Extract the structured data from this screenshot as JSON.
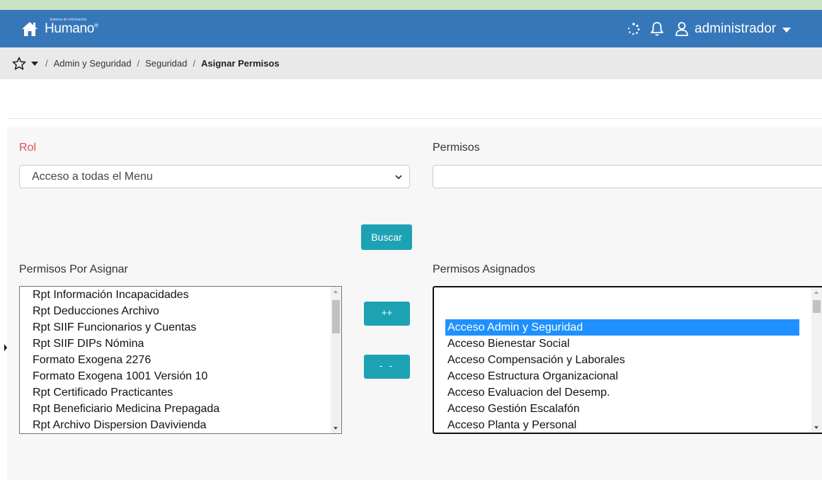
{
  "navbar": {
    "brand": "Humano",
    "brand_mark": "®",
    "brand_tagline": "Sistema de Información",
    "user": "administrador"
  },
  "breadcrumb": {
    "items": [
      "Admin y Seguridad",
      "Seguridad"
    ],
    "current": "Asignar Permisos",
    "separator": "/"
  },
  "form": {
    "rol_label": "Rol",
    "rol_value": "Acceso a todas el Menu",
    "permisos_label": "Permisos",
    "permisos_value": "",
    "buscar_label": "Buscar",
    "add_label": "++",
    "remove_label": "- -",
    "por_asignar_label": "Permisos Por Asignar",
    "asignados_label": "Permisos Asignados"
  },
  "por_asignar": [
    "Rpt Información Incapacidades",
    "Rpt Deducciones Archivo",
    "Rpt SIIF Funcionarios y Cuentas",
    "Rpt SIIF DIPs Nómina",
    "Formato Exogena 2276",
    "Formato Exogena 1001 Versión 10",
    "Rpt Certificado Practicantes",
    "Rpt Beneficiario Medicina Prepagada",
    "Rpt Archivo Dispersion Davivienda"
  ],
  "asignados": [
    "",
    "Acceso Admin y Seguridad",
    "Acceso Bienestar Social",
    "Acceso Compensación y Laborales",
    "Acceso Estructura Organizacional",
    "Acceso Evaluacion del Desemp.",
    "Acceso Gestión Escalafón",
    "Acceso Planta y Personal"
  ],
  "asignados_selected": "Acceso Admin y Seguridad",
  "colors": {
    "navbar": "#3677ba",
    "accent_button": "#1da2b4",
    "selection": "#1e90ff",
    "required_label": "#d9534f"
  }
}
